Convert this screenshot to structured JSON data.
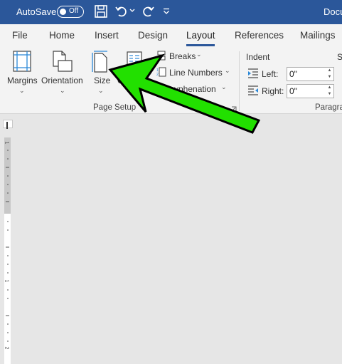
{
  "titlebar": {
    "autosave_label": "AutoSave",
    "toggle_state": "Off",
    "doc_title": "Docu",
    "bg_color": "#2b579a"
  },
  "tabs": [
    "File",
    "Home",
    "Insert",
    "Design",
    "Layout",
    "References",
    "Mailings"
  ],
  "active_tab": "Layout",
  "ribbon": {
    "page_setup": {
      "margins": "Margins",
      "orientation": "Orientation",
      "size": "Size",
      "columns_partial": "Co",
      "breaks": "Breaks",
      "line_numbers": "Line Numbers",
      "hyphenation": "yphenation",
      "group_label": "Page Setup"
    },
    "paragraph": {
      "indent_label": "Indent",
      "left_label": "Left:",
      "left_value": "0\"",
      "right_label": "Right:",
      "right_value": "0\"",
      "group_label_partial": "Paragra",
      "spacing_partial": "S"
    }
  },
  "ruler": {
    "marks": [
      "1",
      "1",
      "2"
    ]
  },
  "annotation": {
    "arrow_color": "#22e000",
    "arrow_outline": "#000000"
  }
}
